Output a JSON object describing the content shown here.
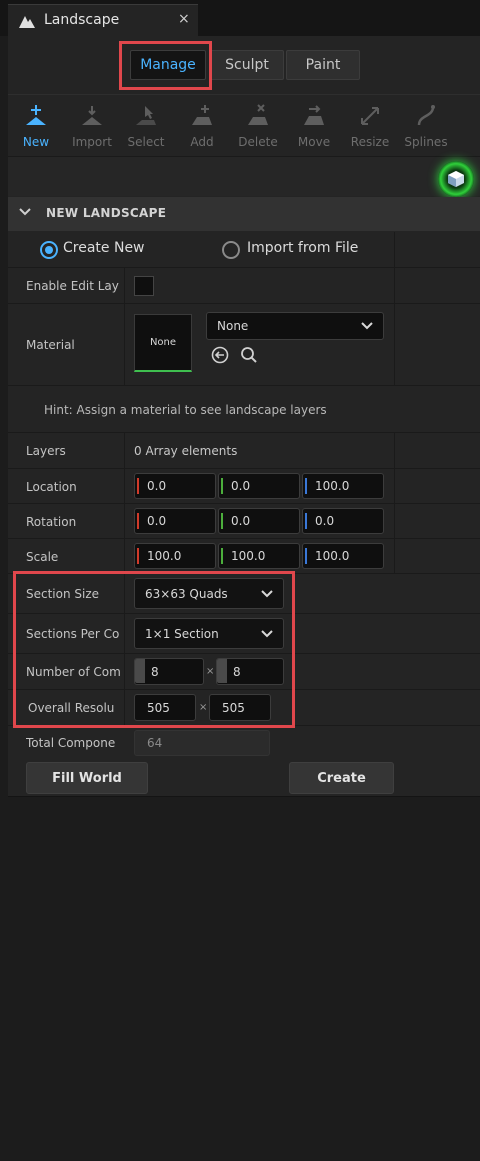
{
  "window": {
    "tab_title": "Landscape",
    "close_glyph": "×",
    "tab_icon": "landscape-mountain-icon"
  },
  "modes": [
    {
      "label": "Manage",
      "active": true
    },
    {
      "label": "Sculpt",
      "active": false
    },
    {
      "label": "Paint",
      "active": false
    }
  ],
  "tools": [
    {
      "label": "New",
      "icon": "new-plus-icon",
      "active": true
    },
    {
      "label": "Import",
      "icon": "import-icon",
      "active": false
    },
    {
      "label": "Select",
      "icon": "select-cursor-icon",
      "active": false
    },
    {
      "label": "Add",
      "icon": "add-component-icon",
      "active": false
    },
    {
      "label": "Delete",
      "icon": "delete-component-icon",
      "active": false
    },
    {
      "label": "Move",
      "icon": "move-component-icon",
      "active": false
    },
    {
      "label": "Resize",
      "icon": "resize-icon",
      "active": false
    },
    {
      "label": "Splines",
      "icon": "splines-icon",
      "active": false
    }
  ],
  "section": {
    "title": "NEW LANDSCAPE"
  },
  "source": {
    "create_new": "Create New",
    "import_file": "Import from File",
    "selected": "create_new"
  },
  "fields": {
    "enable_edit_layers": {
      "label": "Enable Edit Lay",
      "checked": false
    },
    "material": {
      "label": "Material",
      "thumb": "None",
      "value": "None"
    },
    "hint": "Hint: Assign a material to see landscape layers",
    "layers": {
      "label": "Layers",
      "value": "0 Array elements"
    },
    "location": {
      "label": "Location",
      "x": "0.0",
      "y": "0.0",
      "z": "100.0"
    },
    "rotation": {
      "label": "Rotation",
      "x": "0.0",
      "y": "0.0",
      "z": "0.0"
    },
    "scale": {
      "label": "Scale",
      "x": "100.0",
      "y": "100.0",
      "z": "100.0"
    },
    "section_size": {
      "label": "Section Size",
      "value": "63×63 Quads"
    },
    "sections_per_component": {
      "label": "Sections Per Co",
      "value": "1×1 Section"
    },
    "number_of_components": {
      "label": "Number of Com",
      "x": "8",
      "y": "8",
      "sep": "×"
    },
    "overall_resolution": {
      "label": "Overall Resolu",
      "x": "505",
      "y": "505",
      "sep": "×"
    },
    "total_components": {
      "label": "Total Compone",
      "value": "64"
    }
  },
  "buttons": {
    "fill_world": "Fill World",
    "create": "Create"
  },
  "colors": {
    "accent": "#4ab3ff",
    "highlight": "#e0474c",
    "x_axis": "#d03a2a",
    "y_axis": "#4cae3c",
    "z_axis": "#3a78d8"
  }
}
